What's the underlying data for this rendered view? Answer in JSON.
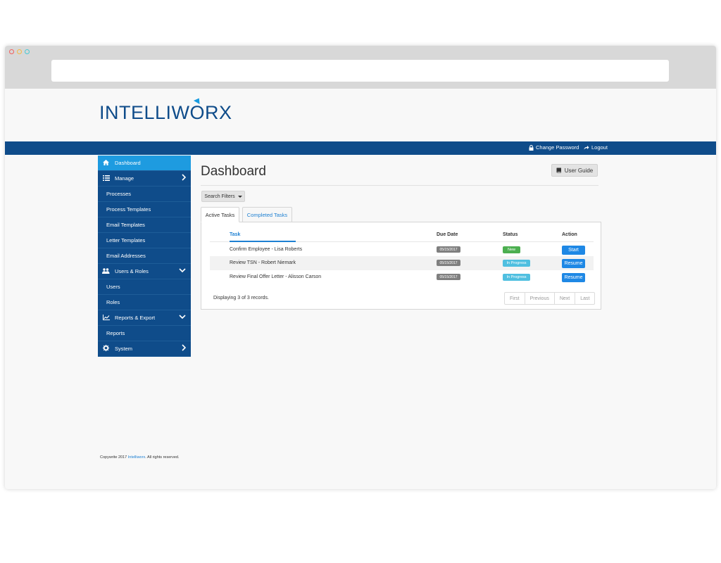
{
  "app": {
    "logo": "INTELLIWORX"
  },
  "topbar": {
    "change_password": "Change Password",
    "logout": "Logout"
  },
  "sidebar": {
    "items": [
      {
        "label": "Dashboard",
        "icon": "home-icon",
        "active": true,
        "type": "head"
      },
      {
        "label": "Manage",
        "icon": "list-icon",
        "type": "head",
        "chevron": "right"
      },
      {
        "label": "Processes",
        "type": "sub"
      },
      {
        "label": "Process Templates",
        "type": "sub"
      },
      {
        "label": "Email Templates",
        "type": "sub"
      },
      {
        "label": "Letter Templates",
        "type": "sub"
      },
      {
        "label": "Email Addresses",
        "type": "sub"
      },
      {
        "label": "Users & Roles",
        "icon": "users-icon",
        "type": "head",
        "chevron": "down"
      },
      {
        "label": "Users",
        "type": "sub"
      },
      {
        "label": "Roles",
        "type": "sub"
      },
      {
        "label": "Reports & Export",
        "icon": "chart-icon",
        "type": "head",
        "chevron": "down"
      },
      {
        "label": "Reports",
        "type": "sub"
      },
      {
        "label": "System",
        "icon": "gear-icon",
        "type": "head",
        "chevron": "right"
      }
    ]
  },
  "main": {
    "title": "Dashboard",
    "user_guide": "User Guide",
    "search_filters": "Search Filters",
    "tabs": [
      "Active Tasks",
      "Completed Tasks"
    ],
    "table": {
      "headers": [
        "Task",
        "Due Date",
        "Status",
        "Action"
      ],
      "rows": [
        {
          "task": "Confirm Employee - Lisa Roberts",
          "due": "05/15/2017",
          "status": "New",
          "action": "Start"
        },
        {
          "task": "Review TSN - Robert Niemark",
          "due": "05/15/2017",
          "status": "In Progress",
          "action": "Resume"
        },
        {
          "task": "Review Final Offer Letter - Alisson Carson",
          "due": "05/15/2017",
          "status": "In Progress",
          "action": "Resume"
        }
      ]
    },
    "summary": "Displaying 3 of 3 records.",
    "pager": [
      "First",
      "Previous",
      "Next",
      "Last"
    ]
  },
  "footer": {
    "prefix": "Copywrite 2017 ",
    "brand": "Intelliworx",
    "suffix": ". All rights reserved."
  },
  "colors": {
    "brand_blue": "#0f4c8a",
    "accent_blue": "#1e9be0",
    "status_new": "#4caf50",
    "status_progress": "#4fbfe0"
  }
}
